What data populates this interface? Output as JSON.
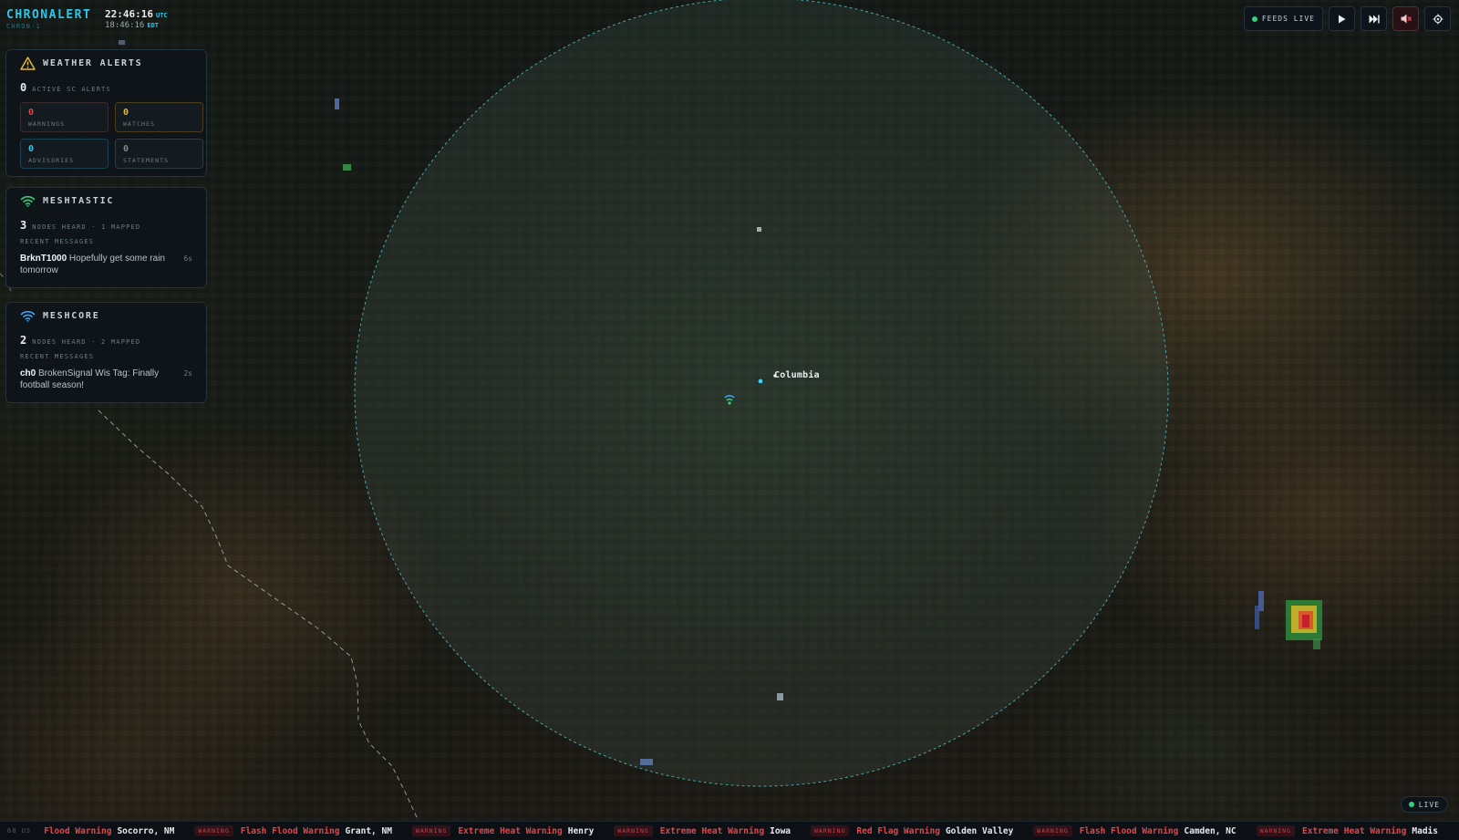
{
  "app": {
    "name": "CHRONALERT",
    "subtitle": "CHRON-1",
    "clock_utc": "22:46:16",
    "clock_utc_tz": "UTC",
    "clock_local": "18:46:16",
    "clock_local_tz": "EDT"
  },
  "weather_alerts": {
    "title": "WEATHER ALERTS",
    "icon": "warning-triangle-icon",
    "active_count": "0",
    "active_label": "ACTIVE SC ALERTS",
    "stats": [
      {
        "key": "warnings",
        "value": "0",
        "label": "WARNINGS",
        "color": "#e0424a"
      },
      {
        "key": "watches",
        "value": "0",
        "label": "WATCHES",
        "color": "#e6b636"
      },
      {
        "key": "advisories",
        "value": "0",
        "label": "ADVISORIES",
        "color": "#2ec6e6"
      },
      {
        "key": "statements",
        "value": "0",
        "label": "STATEMENTS",
        "color": "#7d8a90"
      }
    ]
  },
  "meshtastic": {
    "title": "MESHTASTIC",
    "icon": "wifi-icon",
    "icon_color": "#2fd37a",
    "nodes_count": "3",
    "nodes_label": "NODES HEARD · 1 MAPPED",
    "recent_label": "RECENT MESSAGES",
    "messages": [
      {
        "from": "BrknT1000",
        "text": "Hopefully get some rain tomorrow",
        "age": "6s"
      }
    ]
  },
  "meshcore": {
    "title": "MESHCORE",
    "icon": "wifi-icon",
    "icon_color": "#3aa8ff",
    "nodes_count": "2",
    "nodes_label": "NODES HEARD · 2 MAPPED",
    "recent_label": "RECENT MESSAGES",
    "messages": [
      {
        "from": "ch0",
        "text": "BrokenSignal Wis Tag: Finally football season!",
        "age": "2s"
      }
    ]
  },
  "controls": {
    "feeds_label": "FEEDS LIVE",
    "play_icon": "play-icon",
    "skip_icon": "skip-forward-icon",
    "mute_icon": "speaker-muted-icon",
    "settings_icon": "gear-icon"
  },
  "map": {
    "city_label": "Columbia"
  },
  "live_badge": {
    "label": "LIVE"
  },
  "ticker": {
    "lead": "68 US",
    "items": [
      {
        "badge": "",
        "event": "Flood Warning",
        "place": "Socorro, NM"
      },
      {
        "badge": "WARNING",
        "event": "Flash Flood Warning",
        "place": "Grant, NM"
      },
      {
        "badge": "WARNING",
        "event": "Extreme Heat Warning",
        "place": "Henry"
      },
      {
        "badge": "WARNING",
        "event": "Extreme Heat Warning",
        "place": "Iowa"
      },
      {
        "badge": "WARNING",
        "event": "Red Flag Warning",
        "place": "Golden Valley"
      },
      {
        "badge": "WARNING",
        "event": "Flash Flood Warning",
        "place": "Camden, NC"
      },
      {
        "badge": "WARNING",
        "event": "Extreme Heat Warning",
        "place": "Madis"
      }
    ]
  }
}
